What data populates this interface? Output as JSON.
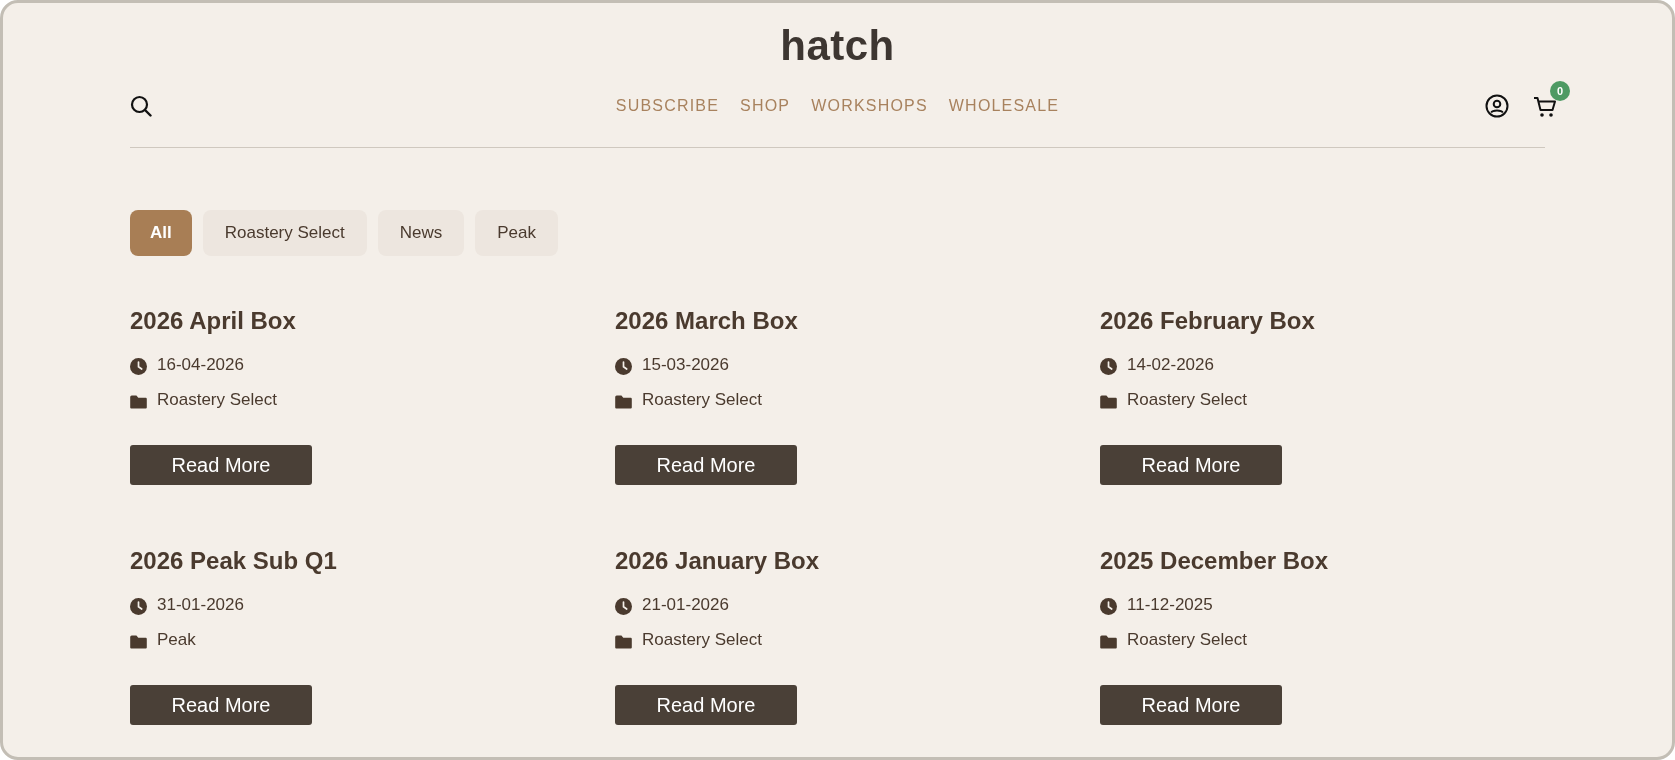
{
  "header": {
    "logo": "hatch",
    "nav": [
      {
        "label": "SUBSCRIBE"
      },
      {
        "label": "SHOP"
      },
      {
        "label": "WORKSHOPS"
      },
      {
        "label": "WHOLESALE"
      }
    ],
    "cart_count": "0"
  },
  "filters": [
    {
      "label": "All",
      "selected": true
    },
    {
      "label": "Roastery Select",
      "selected": false
    },
    {
      "label": "News",
      "selected": false
    },
    {
      "label": "Peak",
      "selected": false
    }
  ],
  "posts": [
    {
      "title": "2026 April Box",
      "date": "16-04-2026",
      "category": "Roastery Select",
      "button": "Read More"
    },
    {
      "title": "2026 March Box",
      "date": "15-03-2026",
      "category": "Roastery Select",
      "button": "Read More"
    },
    {
      "title": "2026 February Box",
      "date": "14-02-2026",
      "category": "Roastery Select",
      "button": "Read More"
    },
    {
      "title": "2026 Peak Sub Q1",
      "date": "31-01-2026",
      "category": "Peak",
      "button": "Read More"
    },
    {
      "title": "2026 January Box",
      "date": "21-01-2026",
      "category": "Roastery Select",
      "button": "Read More"
    },
    {
      "title": "2025 December Box",
      "date": "11-12-2025",
      "category": "Roastery Select",
      "button": "Read More"
    }
  ]
}
